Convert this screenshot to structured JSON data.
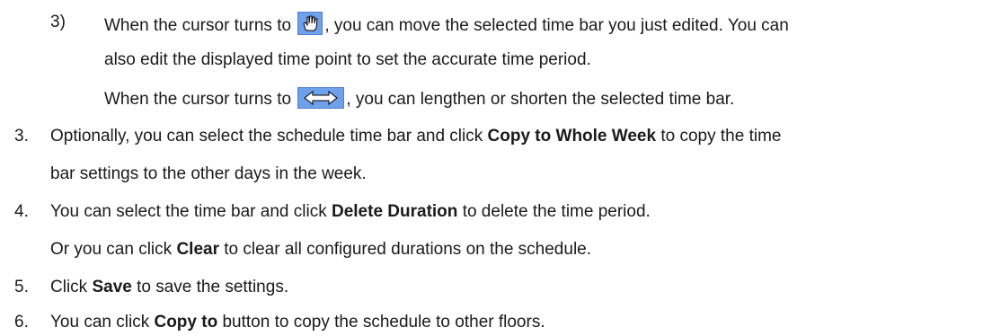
{
  "sub3": {
    "number": "3)",
    "l1a": "When the cursor turns to",
    "l1b": ", you can move the selected time bar you just edited. You can",
    "l2": "also edit the displayed time point to set the accurate time period.",
    "l3a": "When the cursor turns to",
    "l3b": ", you can lengthen or shorten the selected time bar."
  },
  "icons": {
    "move": "hand-cursor-icon",
    "resize": "horizontal-resize-icon"
  },
  "step3": {
    "number": "3.",
    "a": "Optionally, you can select the schedule time bar and click",
    "bold": "Copy to Whole Week",
    "b": "to copy the time",
    "l2": "bar settings to the other days in the week."
  },
  "step4": {
    "number": "4.",
    "a": "You can select the time bar and click",
    "bold": "Delete Duration",
    "b": "to delete the time period.",
    "l2a": "Or you can click",
    "l2bold": "Clear",
    "l2b": "to clear all configured durations on the schedule."
  },
  "step5": {
    "number": "5.",
    "a": "Click",
    "bold": "Save",
    "b": "to save the settings."
  },
  "step6": {
    "number": "6.",
    "a": "You can click",
    "bold": "Copy to",
    "b": "button to copy the schedule to other floors."
  }
}
